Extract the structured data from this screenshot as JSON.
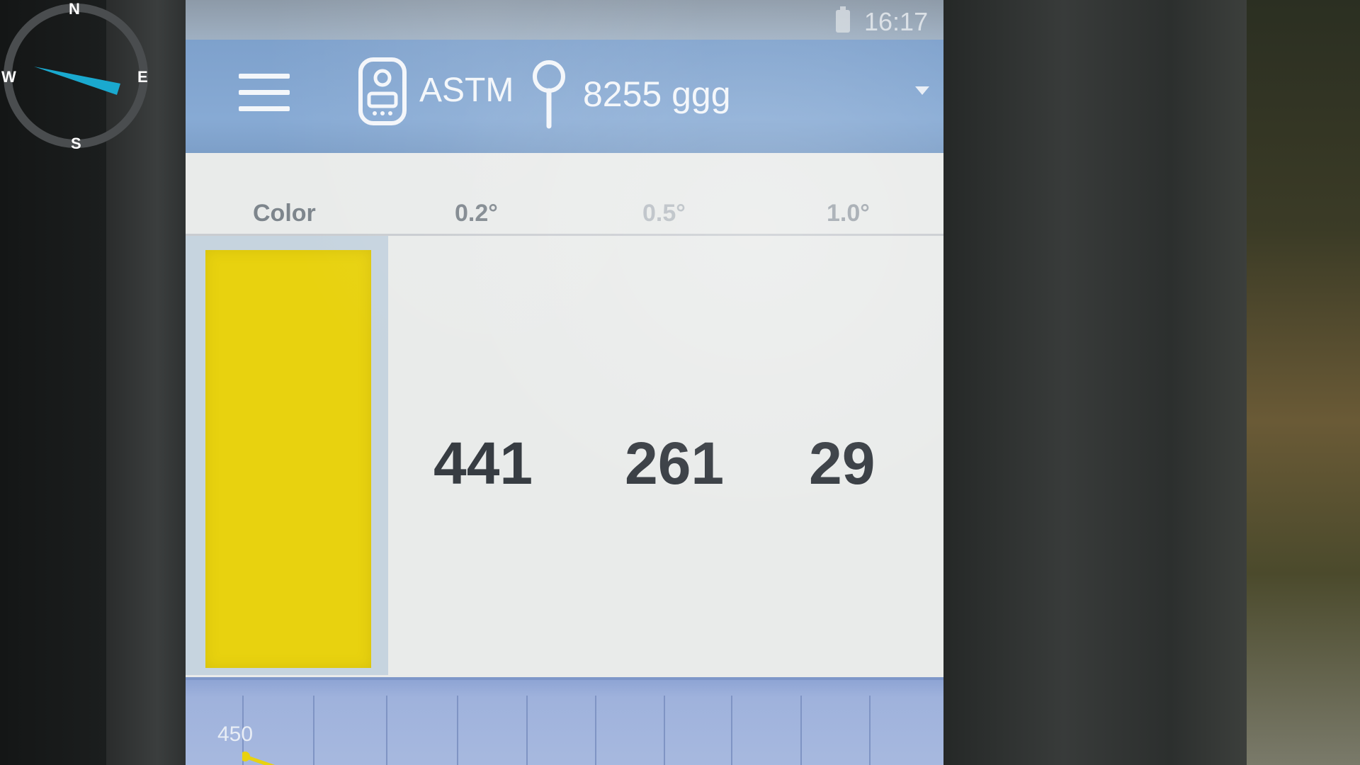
{
  "status_bar": {
    "time": "16:17"
  },
  "toolbar": {
    "mode": "ASTM",
    "sample": "8255 ggg"
  },
  "table": {
    "headers": [
      "Color",
      "0.2°",
      "0.5°",
      "1.0°"
    ],
    "values": [
      "441",
      "261",
      "29"
    ],
    "swatch_color": "#e8d20f"
  },
  "graph": {
    "y_label": "450"
  },
  "compass": {
    "n": "N",
    "e": "E",
    "s": "S",
    "w": "W",
    "needle_color": "#1aa9cf"
  },
  "icons": [
    "menu-icon",
    "device-icon",
    "pin-icon",
    "dropdown-icon",
    "battery-icon"
  ]
}
